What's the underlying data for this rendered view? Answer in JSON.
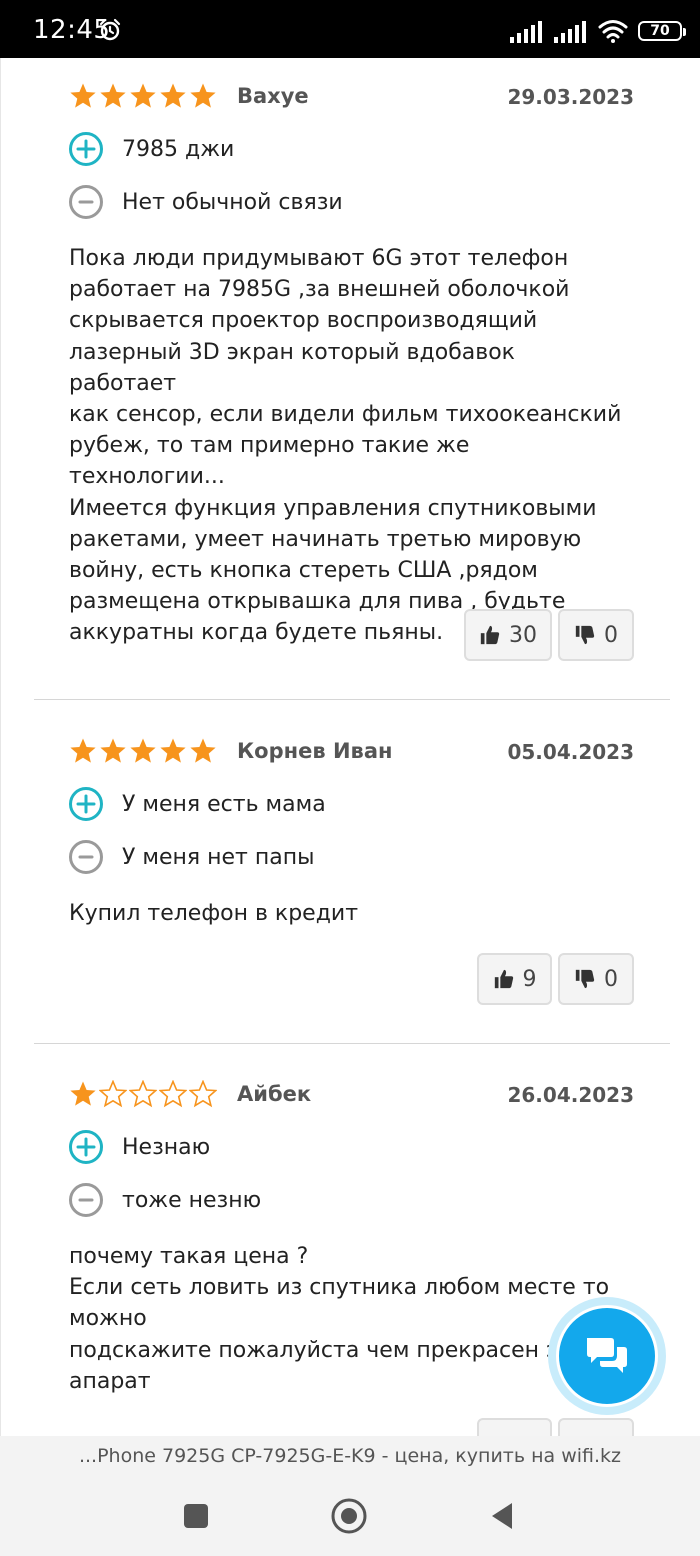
{
  "status_bar": {
    "time": "12:45",
    "battery": "70"
  },
  "colors": {
    "star": "#f7941d",
    "plus": "#1fb4c4",
    "minus": "#9a9a9a",
    "fab": "#13a8ec"
  },
  "reviews": [
    {
      "rating": 5,
      "author": "Вахуе",
      "date": "29.03.2023",
      "pros": "7985 джи",
      "cons": "Нет обычной связи",
      "text": "Пока люди придумывают 6G этот телефон\nработает на 7985G ,за внешней оболочкой\nскрывается проектор воспроизводящий\nлазерный 3D экран который вдобавок работает\nкак сенсор, если видели фильм тихоокеанский\nрубеж, то там примерно такие же технологии...\nИмеется функция управления спутниковыми\nракетами, умеет начинать третью мировую\nвойну, есть кнопка стереть США ,рядом\nразмещена открывашка для пива , будьте\nаккуратны когда будете пьяны.",
      "likes": "30",
      "dislikes": "0"
    },
    {
      "rating": 5,
      "author": "Корнев Иван",
      "date": "05.04.2023",
      "pros": "У меня есть мама",
      "cons": "У меня нет папы",
      "text": "Купил телефон в кредит",
      "likes": "9",
      "dislikes": "0"
    },
    {
      "rating": 1,
      "author": "Айбек",
      "date": "26.04.2023",
      "pros": "Незнаю",
      "cons": "тоже незню",
      "text": "почему такая цена ?\nЕсли сеть ловить из спутника любом месте то\nможно\nподскажите пожалуйста чем прекрасен этот\nапарат"
    }
  ],
  "browser": {
    "url_title": "...Phone 7925G CP-7925G-E-K9 - цена, купить на wifi.kz"
  },
  "icons": {
    "plus": "plus-circle-icon",
    "minus": "minus-circle-icon",
    "thumb_up": "thumbs-up-icon",
    "thumb_down": "thumbs-down-icon",
    "chat": "chat-icon"
  }
}
